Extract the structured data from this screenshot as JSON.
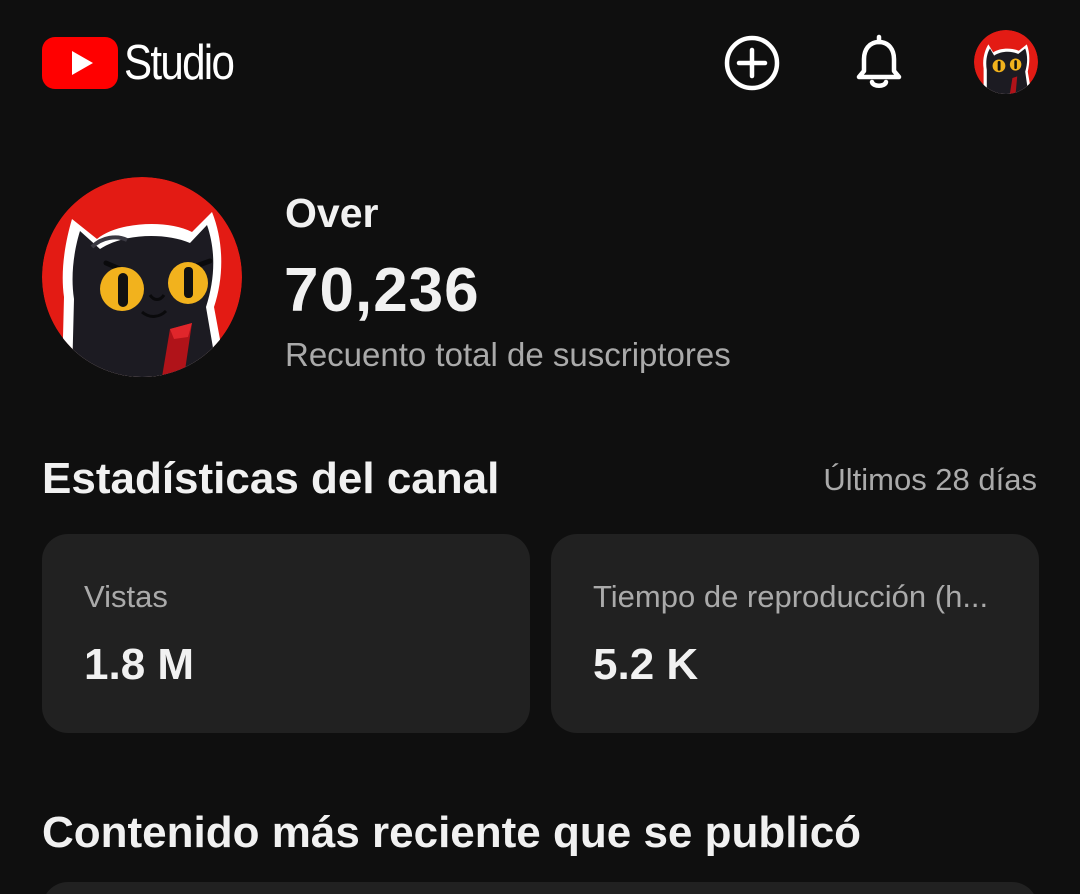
{
  "header": {
    "app_name": "Studio",
    "brand_color": "#ff0000",
    "icons": [
      "youtube-logo-icon",
      "create-plus-icon",
      "bell-icon",
      "account-avatar"
    ]
  },
  "channel": {
    "name": "Over",
    "subscriber_count": "70,236",
    "subscriber_label": "Recuento total de suscriptores"
  },
  "stats": {
    "title": "Estadísticas del canal",
    "period": "Últimos 28 días",
    "cards": [
      {
        "label": "Vistas",
        "value": "1.8 M"
      },
      {
        "label": "Tiempo de reproducción (h...",
        "value": "5.2 K"
      }
    ]
  },
  "recent": {
    "title": "Contenido más reciente que se publicó"
  },
  "colors": {
    "background": "#0f0f0f",
    "card": "#212121",
    "secondary_text": "#aaaaaa",
    "primary_text": "#f1f1f1"
  }
}
